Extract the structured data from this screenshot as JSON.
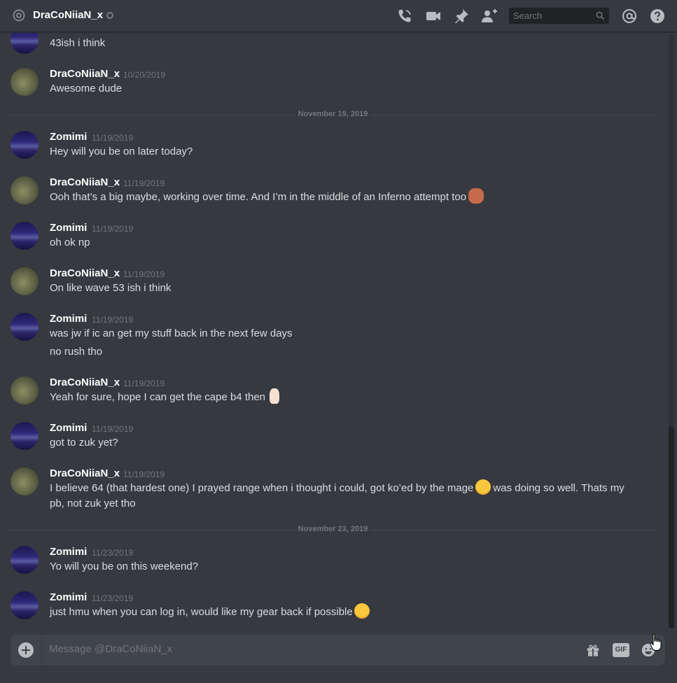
{
  "header": {
    "title": "DraCoNiiaN_x",
    "search_placeholder": "Search",
    "icons": [
      "at-icon",
      "call-icon",
      "video-icon",
      "pin-icon",
      "add-friend-icon",
      "mention-icon",
      "help-icon"
    ]
  },
  "partial_message": {
    "text": "43ish i think"
  },
  "messages": [
    {
      "user": "DraCoNiiaN_x",
      "ts": "10/20/2019",
      "lines": [
        "Awesome dude"
      ]
    },
    {
      "user": "Zomimi",
      "ts": "11/19/2019",
      "lines": [
        "Hey will you be on later today?"
      ]
    },
    {
      "user": "DraCoNiiaN_x",
      "ts": "11/19/2019",
      "lines": [
        "Ooh that’s a big maybe, working over time. And I’m in the middle of an Inferno attempt too"
      ],
      "emoji": "see-no-evil-monkey"
    },
    {
      "user": "Zomimi",
      "ts": "11/19/2019",
      "lines": [
        "oh ok np"
      ]
    },
    {
      "user": "DraCoNiiaN_x",
      "ts": "11/19/2019",
      "lines": [
        "On like wave 53 ish i think"
      ]
    },
    {
      "user": "Zomimi",
      "ts": "11/19/2019",
      "lines": [
        "was jw if ic an get my stuff back in the next few days",
        "no rush tho"
      ]
    },
    {
      "user": "DraCoNiiaN_x",
      "ts": "11/19/2019",
      "lines": [
        "Yeah for sure, hope I can get the cape b4 then"
      ],
      "emoji": "crossed-fingers"
    },
    {
      "user": "Zomimi",
      "ts": "11/19/2019",
      "lines": [
        "got to zuk yet?"
      ]
    },
    {
      "user": "DraCoNiiaN_x",
      "ts": "11/19/2019",
      "text_a": "I believe 64 (that hardest one) I prayed range when i thought i could, got ko’ed by the mage",
      "text_b": "was doing so well. Thats my pb, not zuk yet tho",
      "emoji": "slightly-frowning-face"
    },
    {
      "user": "Zomimi",
      "ts": "11/23/2019",
      "lines": [
        "Yo will you be on this weekend?"
      ]
    },
    {
      "user": "Zomimi",
      "ts": "11/23/2019",
      "lines": [
        "just hmu when you can log in, would like my gear back if possible"
      ],
      "emoji": "slightly-smiling-face"
    }
  ],
  "dividers": [
    "November 19, 2019",
    "November 23, 2019"
  ],
  "composer": {
    "placeholder": "Message @DraCoNiiaN_x",
    "gif_label": "GIF"
  },
  "colors": {
    "background": "#36393f",
    "header_text": "#ffffff",
    "muted": "#72767d",
    "input_bg": "#40444b"
  }
}
